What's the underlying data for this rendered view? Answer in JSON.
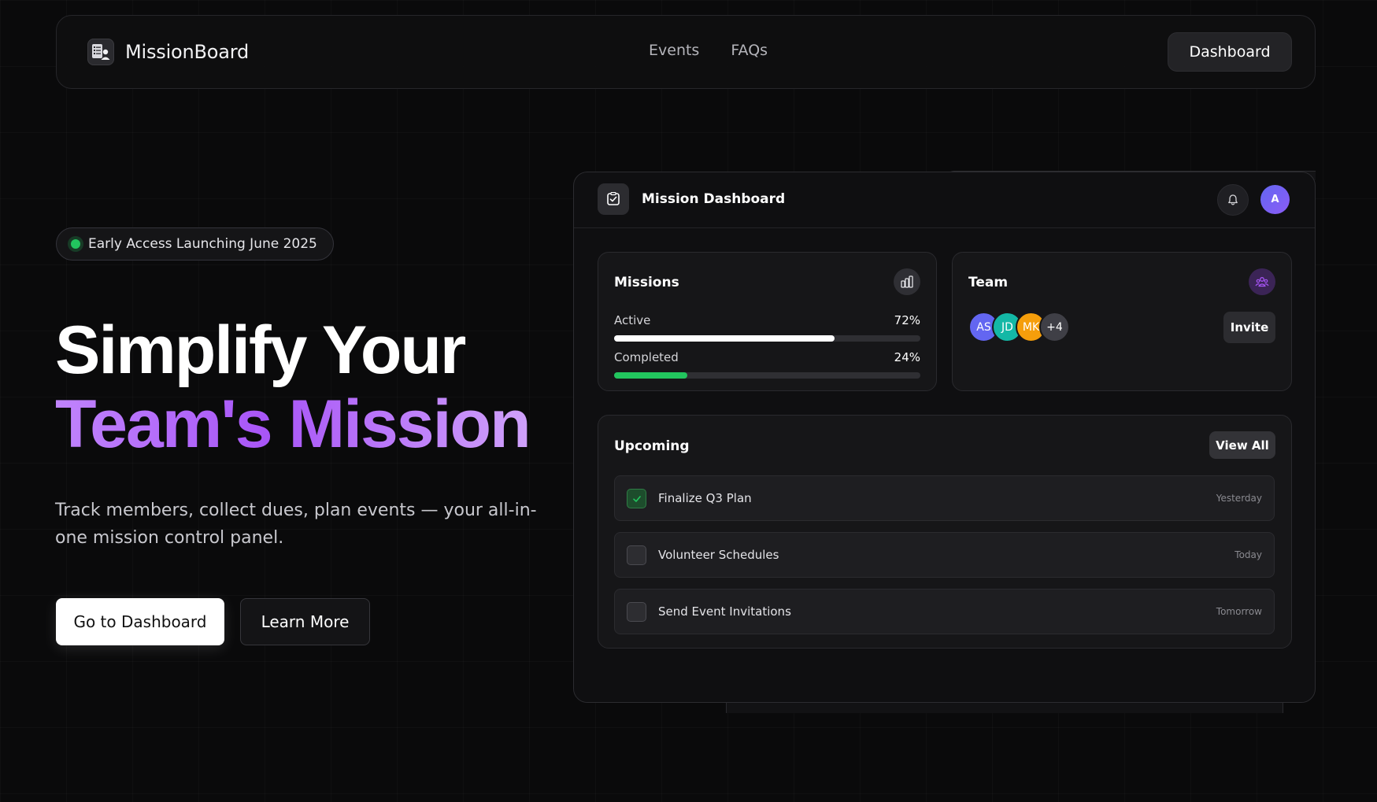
{
  "nav": {
    "brand": "MissionBoard",
    "links": [
      "Events",
      "FAQs"
    ],
    "dashboard_button": "Dashboard"
  },
  "hero": {
    "badge": "Early Access Launching June 2025",
    "title_line1": "Simplify Your",
    "title_line2": "Team's Mission",
    "subtitle": "Track members, collect dues, plan events — your all-in-one mission control panel.",
    "primary_cta": "Go to Dashboard",
    "secondary_cta": "Learn More"
  },
  "panel": {
    "title": "Mission Dashboard",
    "user_initial": "A",
    "missions": {
      "title": "Missions",
      "stats": [
        {
          "label": "Active",
          "value": "72%",
          "fraction": 0.72,
          "color": "#ffffff"
        },
        {
          "label": "Completed",
          "value": "24%",
          "fraction": 0.24,
          "color": "#22c55e"
        }
      ]
    },
    "team": {
      "title": "Team",
      "avatars": [
        {
          "initials": "AS",
          "color": "#6366f1"
        },
        {
          "initials": "JD",
          "color": "#14b8a6"
        },
        {
          "initials": "MK",
          "color": "#f59e0b"
        },
        {
          "initials": "+4",
          "color": "#3f3f46"
        }
      ],
      "invite_button": "Invite"
    },
    "upcoming": {
      "title": "Upcoming",
      "view_all_button": "View All",
      "tasks": [
        {
          "label": "Finalize Q3 Plan",
          "date": "Yesterday",
          "done": true
        },
        {
          "label": "Volunteer Schedules",
          "date": "Today",
          "done": false
        },
        {
          "label": "Send Event Invitations",
          "date": "Tomorrow",
          "done": false
        }
      ]
    }
  },
  "icons": {
    "brand": "checklist-user-icon",
    "panel": "checkbox-icon",
    "bell": "bell-icon",
    "missions": "bar-chart-icon",
    "team": "users-icon",
    "check": "check-icon"
  },
  "colors": {
    "accent_purple": "#a855f7",
    "success_green": "#22c55e",
    "background": "#0a0a0b"
  }
}
